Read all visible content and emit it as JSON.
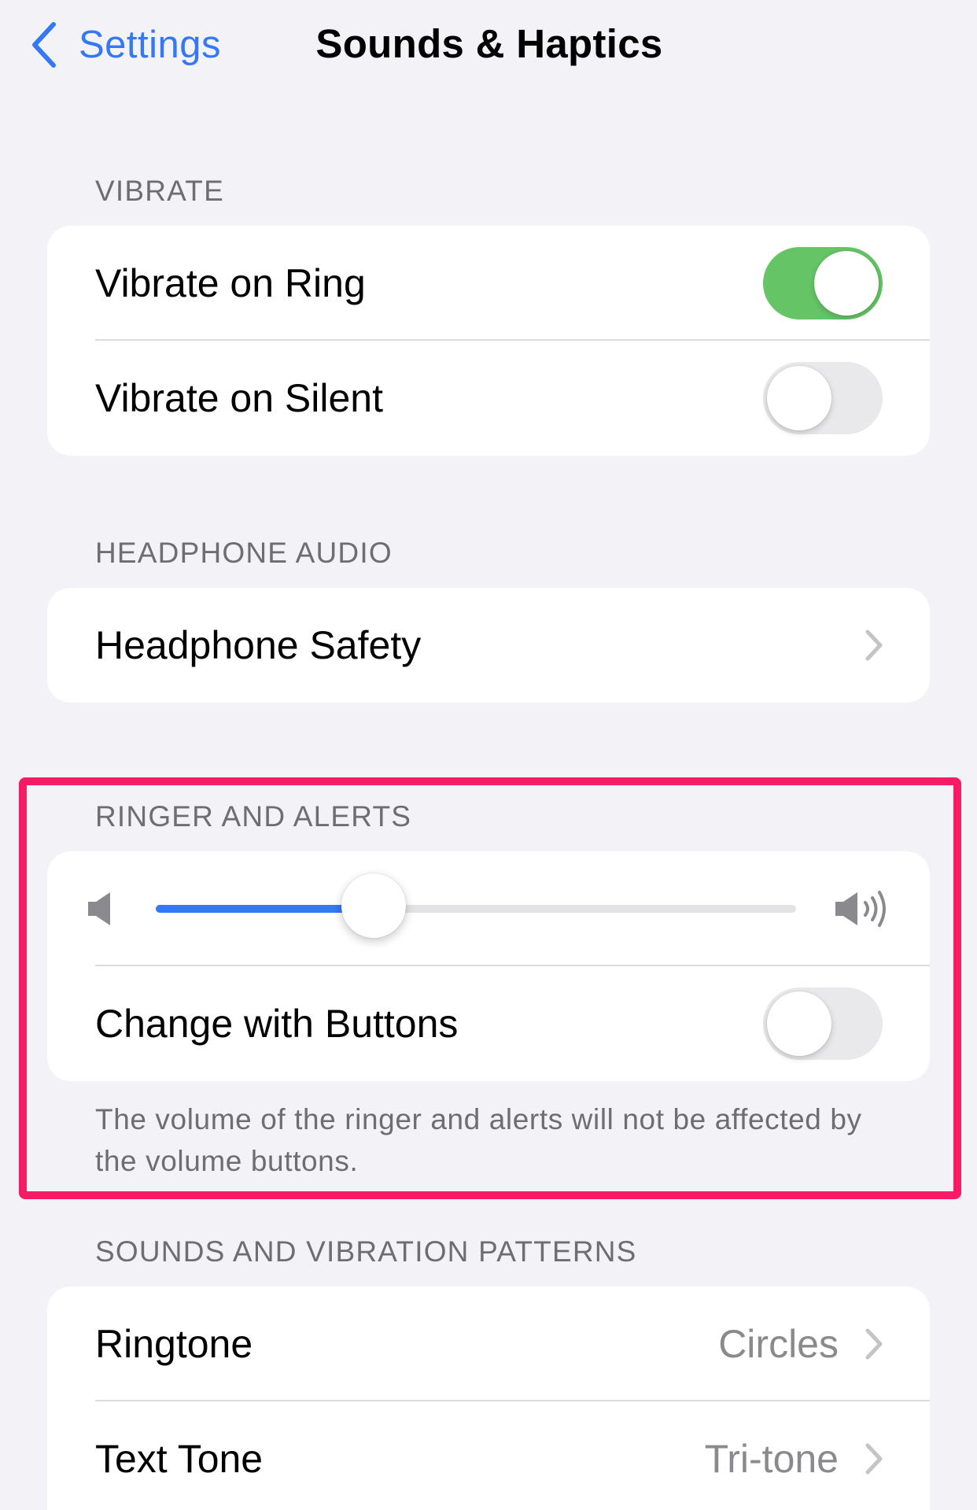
{
  "nav": {
    "back_label": "Settings",
    "title": "Sounds & Haptics"
  },
  "vibrate": {
    "header": "VIBRATE",
    "rows": [
      {
        "label": "Vibrate on Ring",
        "on": true
      },
      {
        "label": "Vibrate on Silent",
        "on": false
      }
    ]
  },
  "headphone_audio": {
    "header": "HEADPHONE AUDIO",
    "rows": [
      {
        "label": "Headphone Safety"
      }
    ]
  },
  "ringer_alerts": {
    "header": "RINGER AND ALERTS",
    "volume_level": 0.34,
    "change_with_buttons": {
      "label": "Change with Buttons",
      "on": false
    },
    "footer": "The volume of the ringer and alerts will not be affected by the volume buttons."
  },
  "sounds_patterns": {
    "header": "SOUNDS AND VIBRATION PATTERNS",
    "rows": [
      {
        "label": "Ringtone",
        "value": "Circles"
      },
      {
        "label": "Text Tone",
        "value": "Tri-tone"
      }
    ]
  },
  "colors": {
    "accent": "#3478f6",
    "toggle_on": "#65c466",
    "highlight": "#f71a64"
  }
}
